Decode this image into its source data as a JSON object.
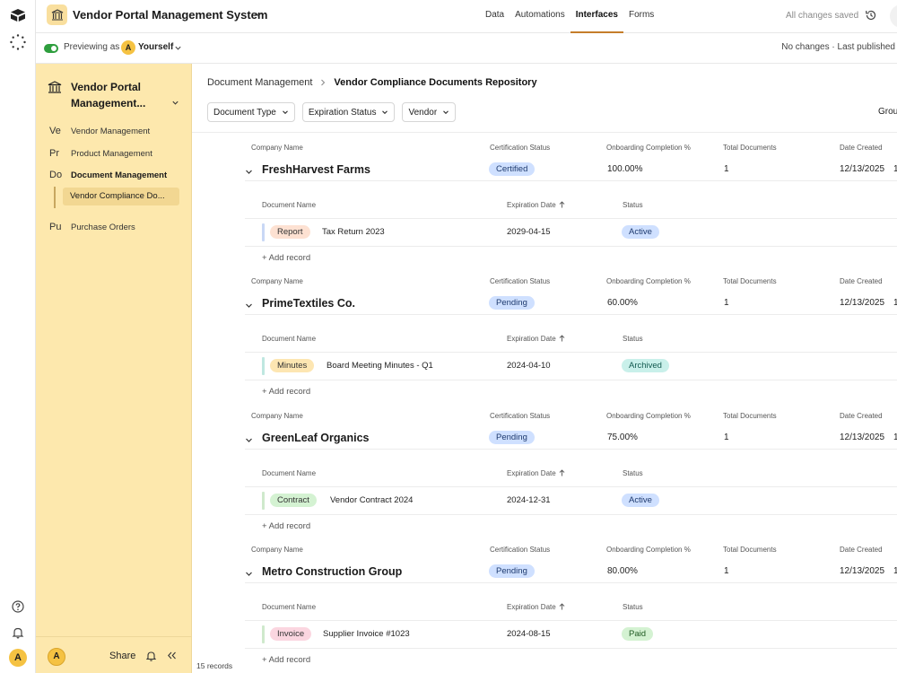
{
  "topbar": {
    "title": "Vendor Portal Management System",
    "nav": [
      "Data",
      "Automations",
      "Interfaces",
      "Forms"
    ],
    "active_nav": "Interfaces",
    "saved_status": "All changes saved"
  },
  "preview": {
    "label": "Previewing as",
    "avatar_letter": "A",
    "user": "Yourself",
    "publish_status": "No changes · Last published"
  },
  "sidebar": {
    "title": "Vendor Portal Management...",
    "items": [
      {
        "abbr": "Ve",
        "label": "Vendor Management"
      },
      {
        "abbr": "Pr",
        "label": "Product Management"
      },
      {
        "abbr": "Do",
        "label": "Document Management"
      },
      {
        "abbr": "Pu",
        "label": "Purchase Orders"
      }
    ],
    "subitem": "Vendor Compliance Do...",
    "avatar_letter": "A",
    "share_label": "Share"
  },
  "rail": {
    "avatar_letter": "A"
  },
  "main": {
    "breadcrumb_parent": "Document Management",
    "breadcrumb_current": "Vendor Compliance Documents Repository",
    "filters": [
      "Document Type",
      "Expiration Status",
      "Vendor"
    ],
    "group_label": "Grou",
    "columns": {
      "company": "Company Name",
      "cert": "Certification Status",
      "onboarding": "Onboarding Completion %",
      "total": "Total Documents",
      "created": "Date Created"
    },
    "sub_columns": {
      "doc_name": "Document Name",
      "expiration": "Expiration Date",
      "status": "Status"
    },
    "add_record": "+ Add record",
    "records_count": "15 records",
    "groups": [
      {
        "company": "FreshHarvest Farms",
        "cert": "Certified",
        "onboarding": "100.00%",
        "total": "1",
        "created": "12/13/2025",
        "trail": "1",
        "doc_type": "Report",
        "doc_name": "Tax Return 2023",
        "expiration": "2029-04-15",
        "status": "Active"
      },
      {
        "company": "PrimeTextiles Co.",
        "cert": "Pending",
        "onboarding": "60.00%",
        "total": "1",
        "created": "12/13/2025",
        "trail": "1",
        "doc_type": "Minutes",
        "doc_name": "Board Meeting Minutes - Q1",
        "expiration": "2024-04-10",
        "status": "Archived"
      },
      {
        "company": "GreenLeaf Organics",
        "cert": "Pending",
        "onboarding": "75.00%",
        "total": "1",
        "created": "12/13/2025",
        "trail": "1",
        "doc_type": "Contract",
        "doc_name": "Vendor Contract 2024",
        "expiration": "2024-12-31",
        "status": "Active"
      },
      {
        "company": "Metro Construction Group",
        "cert": "Pending",
        "onboarding": "80.00%",
        "total": "1",
        "created": "12/13/2025",
        "trail": "1",
        "doc_type": "Invoice",
        "doc_name": "Supplier Invoice #1023",
        "expiration": "2024-08-15",
        "status": "Paid"
      }
    ]
  },
  "colors": {
    "sidebar_bg": "#fde8ad",
    "accent": "#c57d2a",
    "pill_blue": "#cfe0ff",
    "report": "#fde1d2",
    "minutes": "#fde6b2",
    "contract": "#d4f2d2",
    "invoice": "#fbd6e0",
    "active": "#cfe0ff",
    "archived": "#c9f0ea",
    "paid": "#d4f2d2"
  }
}
